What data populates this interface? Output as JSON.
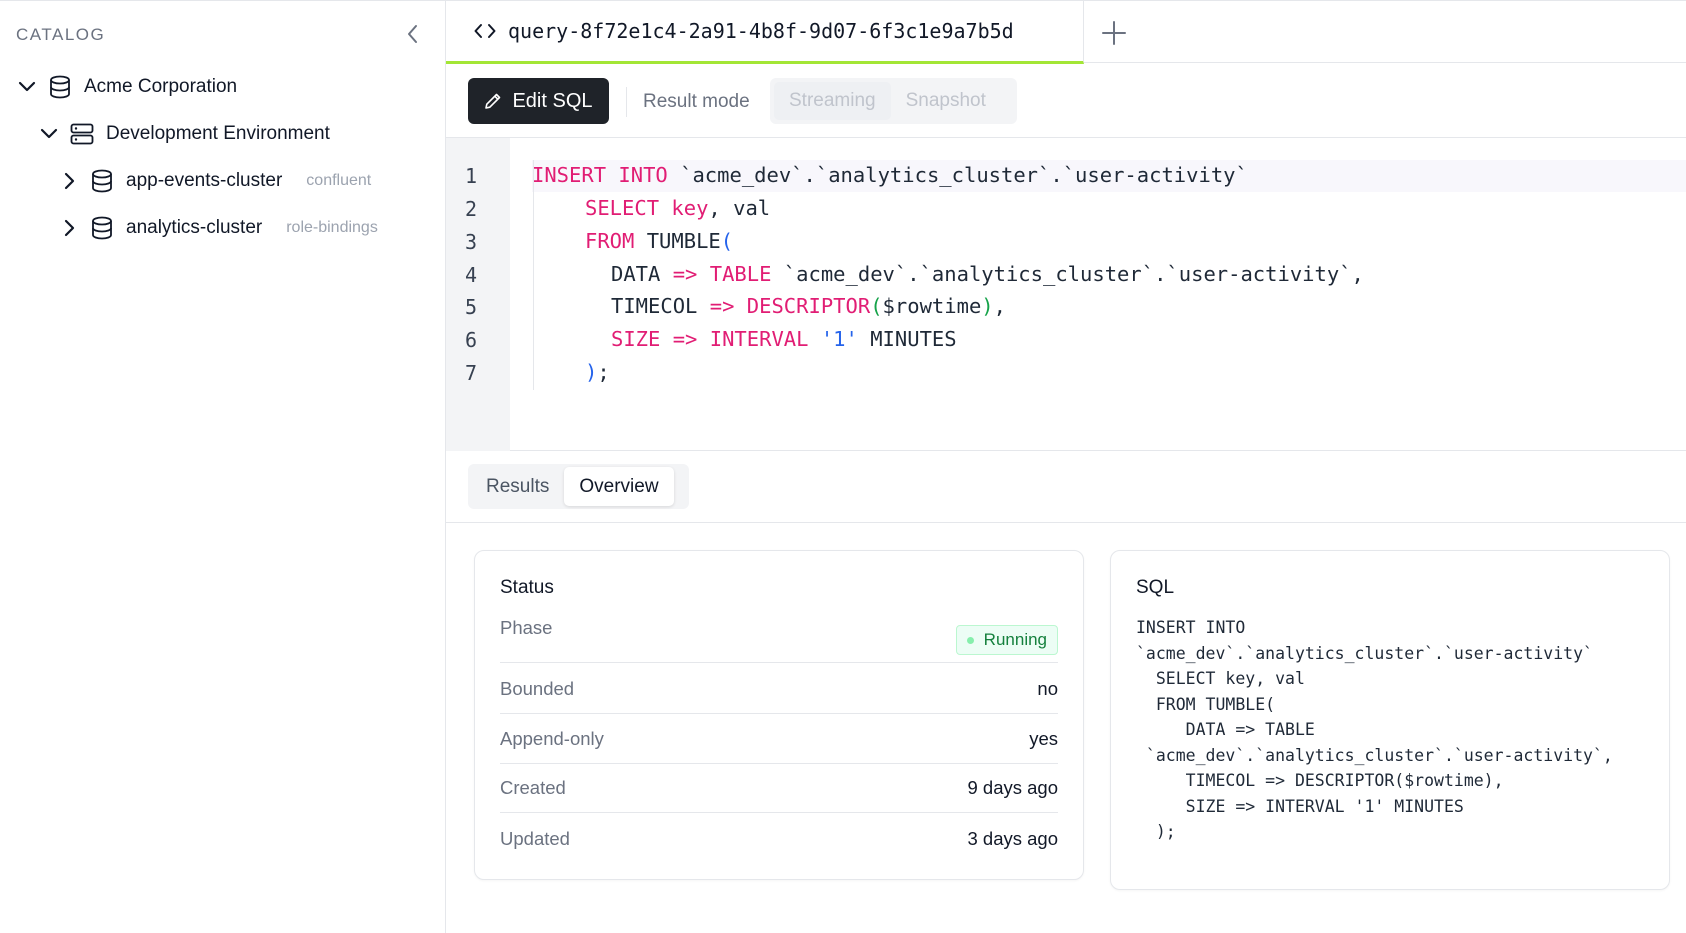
{
  "sidebar": {
    "title": "CATALOG",
    "tree": [
      {
        "label": "Acme Corporation",
        "tag": ""
      },
      {
        "label": "Development Environment",
        "tag": ""
      },
      {
        "label": "app-events-cluster",
        "tag": "confluent"
      },
      {
        "label": "analytics-cluster",
        "tag": "role-bindings"
      }
    ]
  },
  "tabs": {
    "query_tab": "query-8f72e1c4-2a91-4b8f-9d07-6f3c1e9a7b5d"
  },
  "toolbar": {
    "edit_sql": "Edit SQL",
    "result_mode_label": "Result mode",
    "modes": [
      "Streaming",
      "Snapshot"
    ]
  },
  "editor": {
    "line_numbers": [
      "1",
      "2",
      "3",
      "4",
      "5",
      "6",
      "7"
    ],
    "lines": [
      [
        "INSERT INTO",
        " `acme_dev`.`analytics_cluster`.`user-activity`"
      ],
      [
        "SELECT key",
        ", val"
      ],
      [
        "FROM",
        " TUMBLE",
        "("
      ],
      [
        "DATA",
        " =>",
        " TABLE",
        " `acme_dev`.`analytics_cluster`.`user-activity`,"
      ],
      [
        "TIMECOL",
        " =>",
        " DESCRIPTOR",
        "(",
        "$rowtime",
        ")",
        ","
      ],
      [
        "SIZE",
        " =>",
        " INTERVAL",
        " '1'",
        " MINUTES"
      ],
      [
        ")",
        ";"
      ]
    ]
  },
  "result_tabs": [
    "Results",
    "Overview"
  ],
  "status": {
    "title": "Status",
    "rows": [
      {
        "key": "Phase",
        "value": "Running"
      },
      {
        "key": "Bounded",
        "value": "no"
      },
      {
        "key": "Append-only",
        "value": "yes"
      },
      {
        "key": "Created",
        "value": "9 days ago"
      },
      {
        "key": "Updated",
        "value": "3 days ago"
      }
    ]
  },
  "sql_panel": {
    "title": "SQL",
    "text": "INSERT INTO\n`acme_dev`.`analytics_cluster`.`user-activity`\n  SELECT key, val\n  FROM TUMBLE(\n     DATA => TABLE\n `acme_dev`.`analytics_cluster`.`user-activity`,\n     TIMECOL => DESCRIPTOR($rowtime),\n     SIZE => INTERVAL '1' MINUTES\n  );"
  },
  "colors": {
    "accent_tab": "#a3e635",
    "keyword": "#e11d74",
    "string": "#2563eb",
    "running_badge": "#15803d"
  }
}
